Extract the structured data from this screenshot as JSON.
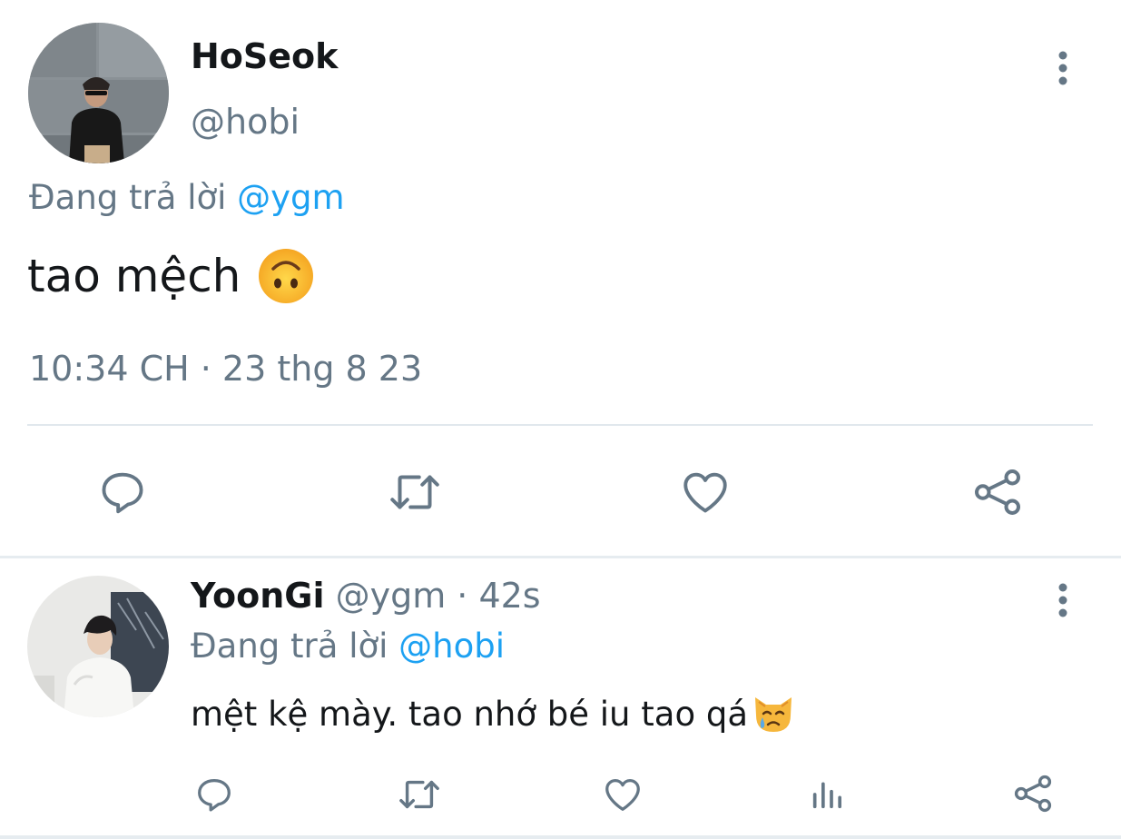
{
  "main_tweet": {
    "display_name": "HoSeok",
    "handle": "@hobi",
    "replying_prefix": "Đang trả lời ",
    "replying_to": "@ygm",
    "text": "tao mệch",
    "emoji": "upside-down-face",
    "timestamp": "10:34 CH · 23 thg 8 23",
    "actions": [
      "reply-icon",
      "retweet-icon",
      "like-icon",
      "share-icon"
    ]
  },
  "reply_tweet": {
    "display_name": "YoonGi",
    "handle_time": " @ygm · 42s",
    "replying_prefix": "Đang trả lời ",
    "replying_to": "@hobi",
    "text": "mệt kệ mày. tao nhớ bé iu tao qá",
    "emoji": "crying-cat-face",
    "actions": [
      "reply-icon",
      "retweet-icon",
      "like-icon",
      "analytics-icon",
      "share-icon"
    ]
  },
  "colors": {
    "text_primary": "#14171a",
    "text_secondary": "#657786",
    "accent": "#1da1f2",
    "divider": "#e1e8ed"
  }
}
